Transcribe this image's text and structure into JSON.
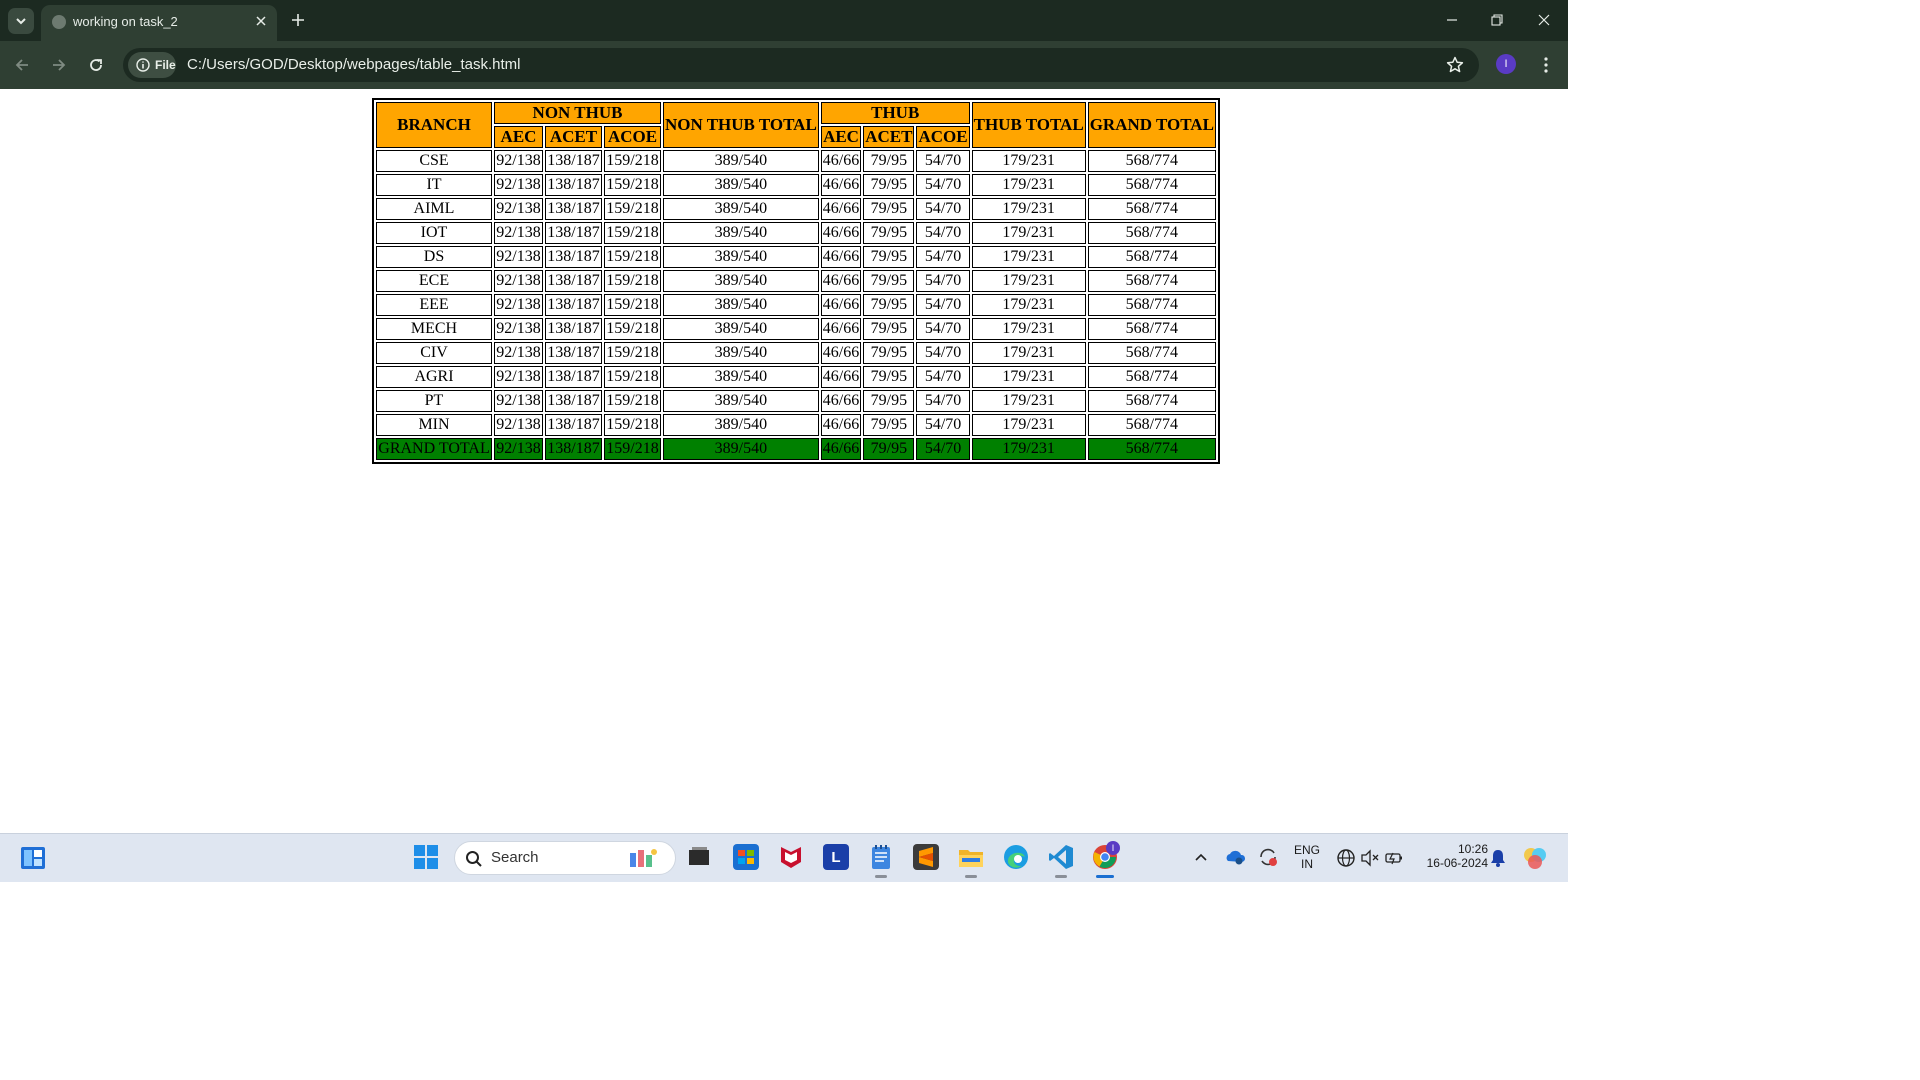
{
  "browser": {
    "tab_title": "working on task_2",
    "site_chip_label": "File",
    "url": "C:/Users/GOD/Desktop/webpages/table_task.html",
    "profile_initial": "I"
  },
  "table": {
    "headers": {
      "branch": "BRANCH",
      "non_thub": "NON THUB",
      "non_thub_total": "NON THUB TOTAL",
      "thub": "THUB",
      "thub_total": "THUB TOTAL",
      "grand_total": "GRAND TOTAL",
      "aec": "AEC",
      "acet": "ACET",
      "acoe": "ACOE"
    },
    "rows": [
      {
        "branch": "CSE",
        "nt_aec": "92/138",
        "nt_acet": "138/187",
        "nt_acoe": "159/218",
        "nt_total": "389/540",
        "t_aec": "46/66",
        "t_acet": "79/95",
        "t_acoe": "54/70",
        "t_total": "179/231",
        "grand": "568/774"
      },
      {
        "branch": "IT",
        "nt_aec": "92/138",
        "nt_acet": "138/187",
        "nt_acoe": "159/218",
        "nt_total": "389/540",
        "t_aec": "46/66",
        "t_acet": "79/95",
        "t_acoe": "54/70",
        "t_total": "179/231",
        "grand": "568/774"
      },
      {
        "branch": "AIML",
        "nt_aec": "92/138",
        "nt_acet": "138/187",
        "nt_acoe": "159/218",
        "nt_total": "389/540",
        "t_aec": "46/66",
        "t_acet": "79/95",
        "t_acoe": "54/70",
        "t_total": "179/231",
        "grand": "568/774"
      },
      {
        "branch": "IOT",
        "nt_aec": "92/138",
        "nt_acet": "138/187",
        "nt_acoe": "159/218",
        "nt_total": "389/540",
        "t_aec": "46/66",
        "t_acet": "79/95",
        "t_acoe": "54/70",
        "t_total": "179/231",
        "grand": "568/774"
      },
      {
        "branch": "DS",
        "nt_aec": "92/138",
        "nt_acet": "138/187",
        "nt_acoe": "159/218",
        "nt_total": "389/540",
        "t_aec": "46/66",
        "t_acet": "79/95",
        "t_acoe": "54/70",
        "t_total": "179/231",
        "grand": "568/774"
      },
      {
        "branch": "ECE",
        "nt_aec": "92/138",
        "nt_acet": "138/187",
        "nt_acoe": "159/218",
        "nt_total": "389/540",
        "t_aec": "46/66",
        "t_acet": "79/95",
        "t_acoe": "54/70",
        "t_total": "179/231",
        "grand": "568/774"
      },
      {
        "branch": "EEE",
        "nt_aec": "92/138",
        "nt_acet": "138/187",
        "nt_acoe": "159/218",
        "nt_total": "389/540",
        "t_aec": "46/66",
        "t_acet": "79/95",
        "t_acoe": "54/70",
        "t_total": "179/231",
        "grand": "568/774"
      },
      {
        "branch": "MECH",
        "nt_aec": "92/138",
        "nt_acet": "138/187",
        "nt_acoe": "159/218",
        "nt_total": "389/540",
        "t_aec": "46/66",
        "t_acet": "79/95",
        "t_acoe": "54/70",
        "t_total": "179/231",
        "grand": "568/774"
      },
      {
        "branch": "CIV",
        "nt_aec": "92/138",
        "nt_acet": "138/187",
        "nt_acoe": "159/218",
        "nt_total": "389/540",
        "t_aec": "46/66",
        "t_acet": "79/95",
        "t_acoe": "54/70",
        "t_total": "179/231",
        "grand": "568/774"
      },
      {
        "branch": "AGRI",
        "nt_aec": "92/138",
        "nt_acet": "138/187",
        "nt_acoe": "159/218",
        "nt_total": "389/540",
        "t_aec": "46/66",
        "t_acet": "79/95",
        "t_acoe": "54/70",
        "t_total": "179/231",
        "grand": "568/774"
      },
      {
        "branch": "PT",
        "nt_aec": "92/138",
        "nt_acet": "138/187",
        "nt_acoe": "159/218",
        "nt_total": "389/540",
        "t_aec": "46/66",
        "t_acet": "79/95",
        "t_acoe": "54/70",
        "t_total": "179/231",
        "grand": "568/774"
      },
      {
        "branch": "MIN",
        "nt_aec": "92/138",
        "nt_acet": "138/187",
        "nt_acoe": "159/218",
        "nt_total": "389/540",
        "t_aec": "46/66",
        "t_acet": "79/95",
        "t_acoe": "54/70",
        "t_total": "179/231",
        "grand": "568/774"
      }
    ],
    "total_row": {
      "branch": "GRAND TOTAL",
      "nt_aec": "92/138",
      "nt_acet": "138/187",
      "nt_acoe": "159/218",
      "nt_total": "389/540",
      "t_aec": "46/66",
      "t_acet": "79/95",
      "t_acoe": "54/70",
      "t_total": "179/231",
      "grand": "568/774"
    },
    "header_color": "#ffa500",
    "total_row_color": "#008000"
  },
  "taskbar": {
    "search_label": "Search",
    "app_icons": [
      "widgets-icon",
      "start-icon",
      "search-icon",
      "copilot-icon",
      "task-view-icon",
      "store-icon",
      "mcafee-icon",
      "l-app-icon",
      "notepad-icon",
      "sublime-icon",
      "file-explorer-icon",
      "edge-icon",
      "vscode-icon",
      "chrome-icon"
    ],
    "language_top": "ENG",
    "language_bottom": "IN",
    "time": "10:26",
    "date": "16-06-2024"
  }
}
